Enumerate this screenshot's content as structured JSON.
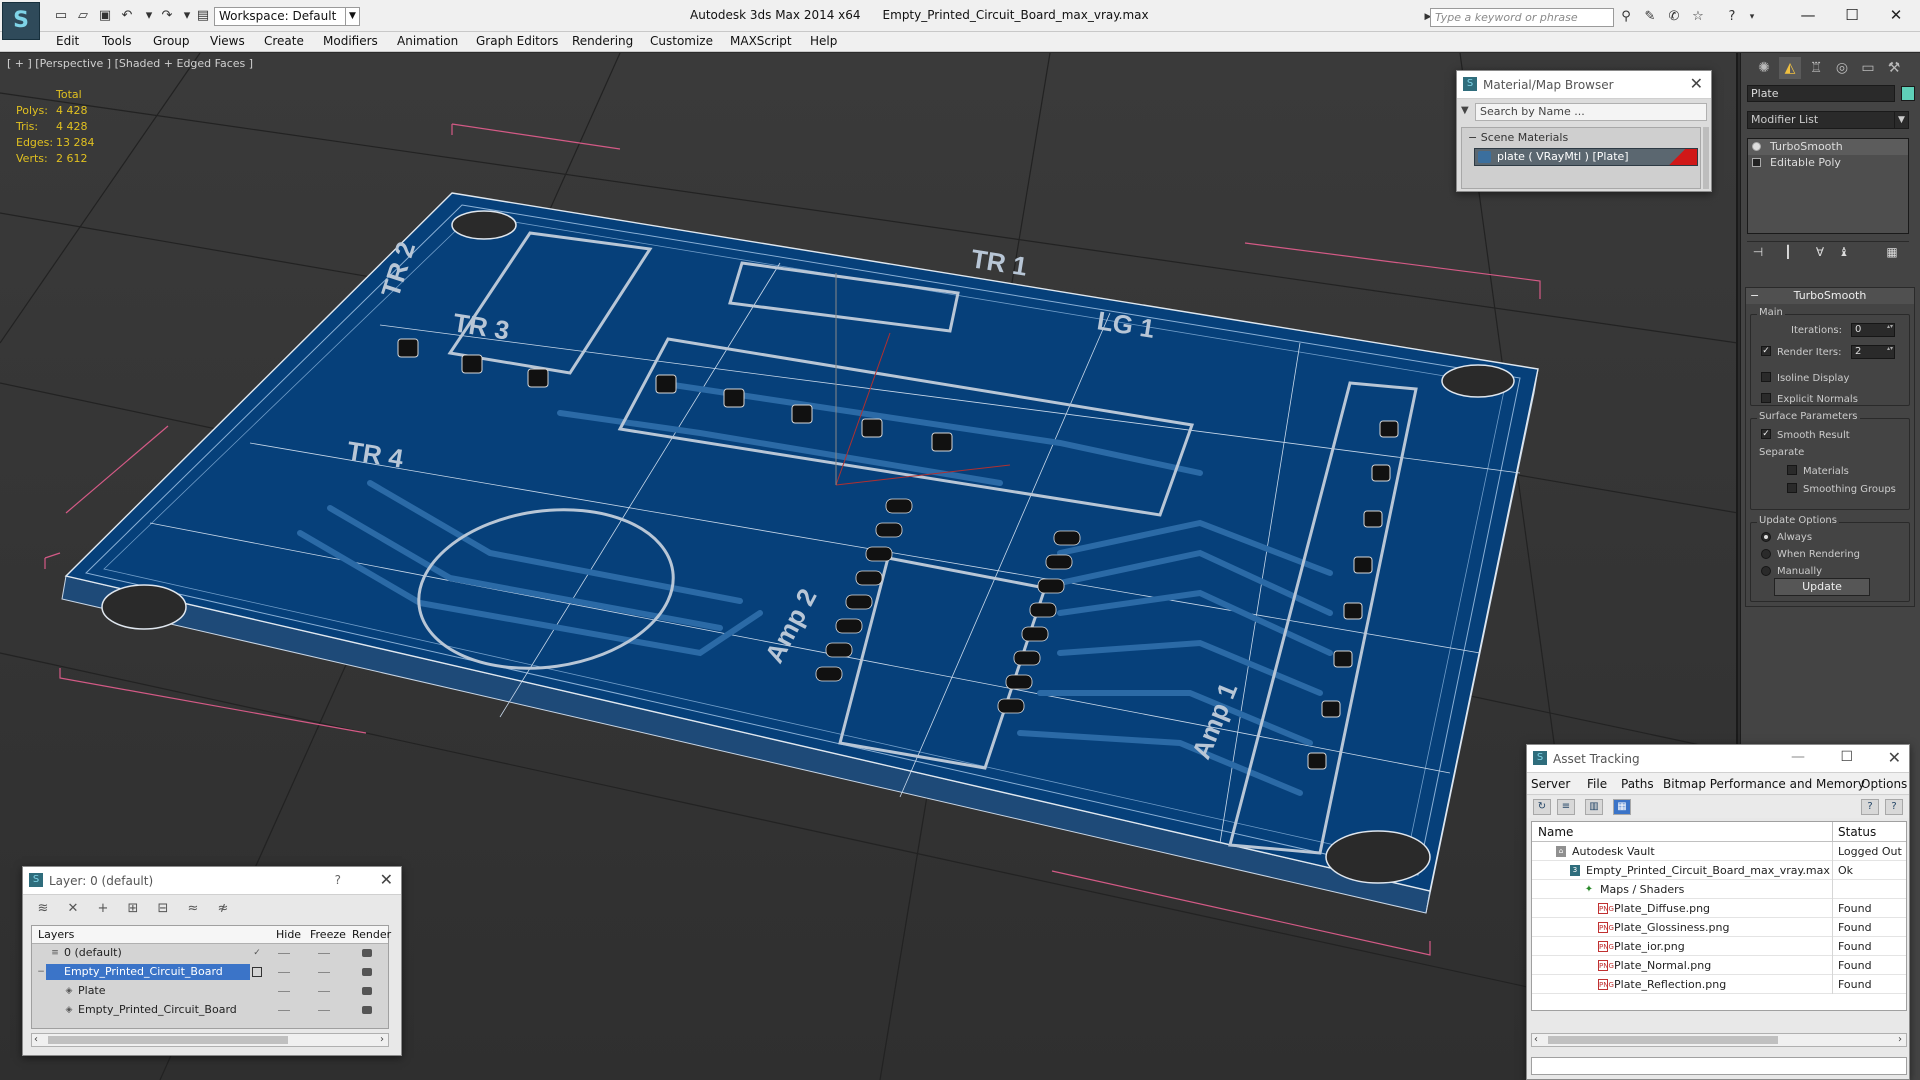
{
  "titlebar": {
    "logo": "S",
    "workspace": "Workspace: Default",
    "app_name": "Autodesk 3ds Max  2014 x64",
    "file_name": "Empty_Printed_Circuit_Board_max_vray.max",
    "search_placeholder": "Type a keyword or phrase"
  },
  "menu": [
    "Edit",
    "Tools",
    "Group",
    "Views",
    "Create",
    "Modifiers",
    "Animation",
    "Graph Editors",
    "Rendering",
    "Customize",
    "MAXScript",
    "Help"
  ],
  "viewport": {
    "label": "[ + ] [Perspective ] [Shaded + Edged Faces ]",
    "stats": {
      "header": "Total",
      "rows": [
        {
          "k": "Polys:",
          "v": "4 428"
        },
        {
          "k": "Tris:",
          "v": "4 428"
        },
        {
          "k": "Edges:",
          "v": "13 284"
        },
        {
          "k": "Verts:",
          "v": "2 612"
        }
      ]
    },
    "pcb_labels": [
      "TR 2",
      "TR 1",
      "TR 3",
      "LG 1",
      "TR 4",
      "Amp 2",
      "Amp 1"
    ],
    "colors": {
      "board": "#06407a",
      "board_top": "#0a4e92",
      "trace": "#2b6aa6",
      "silk": "#b8c6d6"
    }
  },
  "material_browser": {
    "title": "Material/Map Browser",
    "search": "Search by Name ...",
    "section": "Scene Materials",
    "item": "plate  ( VRayMtl )  [Plate]"
  },
  "command_panel": {
    "object_name": "Plate",
    "modifier_list": "Modifier List",
    "stack": [
      "TurboSmooth",
      "Editable Poly"
    ],
    "rollout_title": "TurboSmooth",
    "main_group": "Main",
    "iterations_label": "Iterations:",
    "iterations_value": "0",
    "render_iters_label": "Render Iters:",
    "render_iters_value": "2",
    "isoline_display": "Isoline Display",
    "explicit_normals": "Explicit Normals",
    "surface_params": "Surface Parameters",
    "smooth_result": "Smooth Result",
    "separate": "Separate",
    "materials": "Materials",
    "smoothing_groups": "Smoothing Groups",
    "update_options": "Update Options",
    "always": "Always",
    "when_rendering": "When Rendering",
    "manually": "Manually",
    "update_button": "Update"
  },
  "layer_dialog": {
    "title": "Layer: 0 (default)",
    "help": "?",
    "columns": [
      "Layers",
      "Hide",
      "Freeze",
      "Render"
    ],
    "rows": [
      {
        "name": "0 (default)",
        "selected": false
      },
      {
        "name": "Empty_Printed_Circuit_Board",
        "selected": true
      },
      {
        "name": "Plate",
        "selected": false
      },
      {
        "name": "Empty_Printed_Circuit_Board",
        "selected": false
      }
    ]
  },
  "asset_tracking": {
    "title": "Asset Tracking",
    "menu": [
      "Server",
      "File",
      "Paths",
      "Bitmap Performance and Memory",
      "Options"
    ],
    "columns": [
      "Name",
      "Status"
    ],
    "rows": [
      {
        "name": "Autodesk Vault",
        "status": "Logged Out",
        "indent": 1,
        "icon": "vault"
      },
      {
        "name": "Empty_Printed_Circuit_Board_max_vray.max",
        "status": "Ok",
        "indent": 2,
        "icon": "max"
      },
      {
        "name": "Maps / Shaders",
        "status": "",
        "indent": 3,
        "icon": "maps"
      },
      {
        "name": "Plate_Diffuse.png",
        "status": "Found",
        "indent": 4,
        "icon": "png"
      },
      {
        "name": "Plate_Glossiness.png",
        "status": "Found",
        "indent": 4,
        "icon": "png"
      },
      {
        "name": "Plate_ior.png",
        "status": "Found",
        "indent": 4,
        "icon": "png"
      },
      {
        "name": "Plate_Normal.png",
        "status": "Found",
        "indent": 4,
        "icon": "png"
      },
      {
        "name": "Plate_Reflection.png",
        "status": "Found",
        "indent": 4,
        "icon": "png"
      }
    ]
  }
}
